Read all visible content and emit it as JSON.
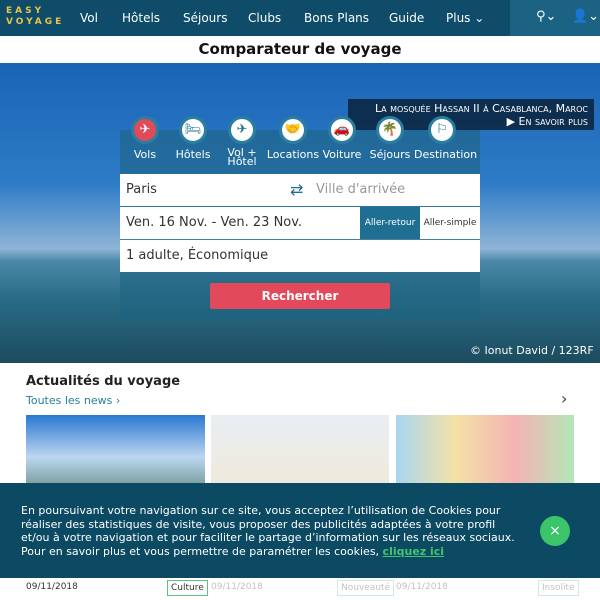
{
  "nav": {
    "logo": [
      "EASY",
      "VOYAGE"
    ],
    "items": [
      "Vol",
      "Hôtels",
      "Séjours",
      "Clubs",
      "Bons Plans",
      "Guide",
      "Plus ⌄"
    ],
    "search_icon": "search-icon",
    "user_icon": "user-icon"
  },
  "title": "Comparateur de voyage",
  "caption": {
    "title": "La mosquée Hassan II à Casablanca, Maroc",
    "more": "▶ En savoir plus"
  },
  "tabs": [
    {
      "label": "Vols",
      "icon": "✈"
    },
    {
      "label": "Hôtels",
      "icon": "🛏"
    },
    {
      "label": "Vol + Hôtel",
      "icon": "✈"
    },
    {
      "label": "Locations",
      "icon": "🤝"
    },
    {
      "label": "Voiture",
      "icon": "🚗"
    },
    {
      "label": "Séjours",
      "icon": "🌴"
    },
    {
      "label": "Destination",
      "icon": "⚐"
    }
  ],
  "search": {
    "from": "Paris",
    "to_placeholder": "Ville d'arrivée",
    "dates": "Ven. 16 Nov. - Ven. 23 Nov.",
    "round_trip": "Aller-retour",
    "one_way": "Aller-simple",
    "passengers": "1 adulte, Économique",
    "submit": "Rechercher"
  },
  "credit": "© Ionut David / 123RF",
  "news": {
    "heading": "Actualités du voyage",
    "all": "Toutes les news ›",
    "items": [
      {
        "date": "09/11/2018",
        "tag": "Culture"
      },
      {
        "date": "09/11/2018",
        "tag": "Nouveauté"
      },
      {
        "date": "09/11/2018",
        "tag": "Insolite"
      }
    ]
  },
  "cookie": {
    "text": "En poursuivant votre navigation sur ce site, vous acceptez l’utilisation de Cookies pour réaliser des statistiques de visite, vous proposer des publicités adaptées à votre profil et/ou à votre navigation et pour faciliter le partage d’information sur les réseaux sociaux. Pour en savoir plus et vous permettre de paramétrer les cookies, ",
    "link": "cliquez ici",
    "close": "×"
  },
  "colors": {
    "nav": "#0e4c69",
    "accent": "#e24a5b",
    "primary": "#1e6f91",
    "cookie_close": "#3cc46a"
  }
}
